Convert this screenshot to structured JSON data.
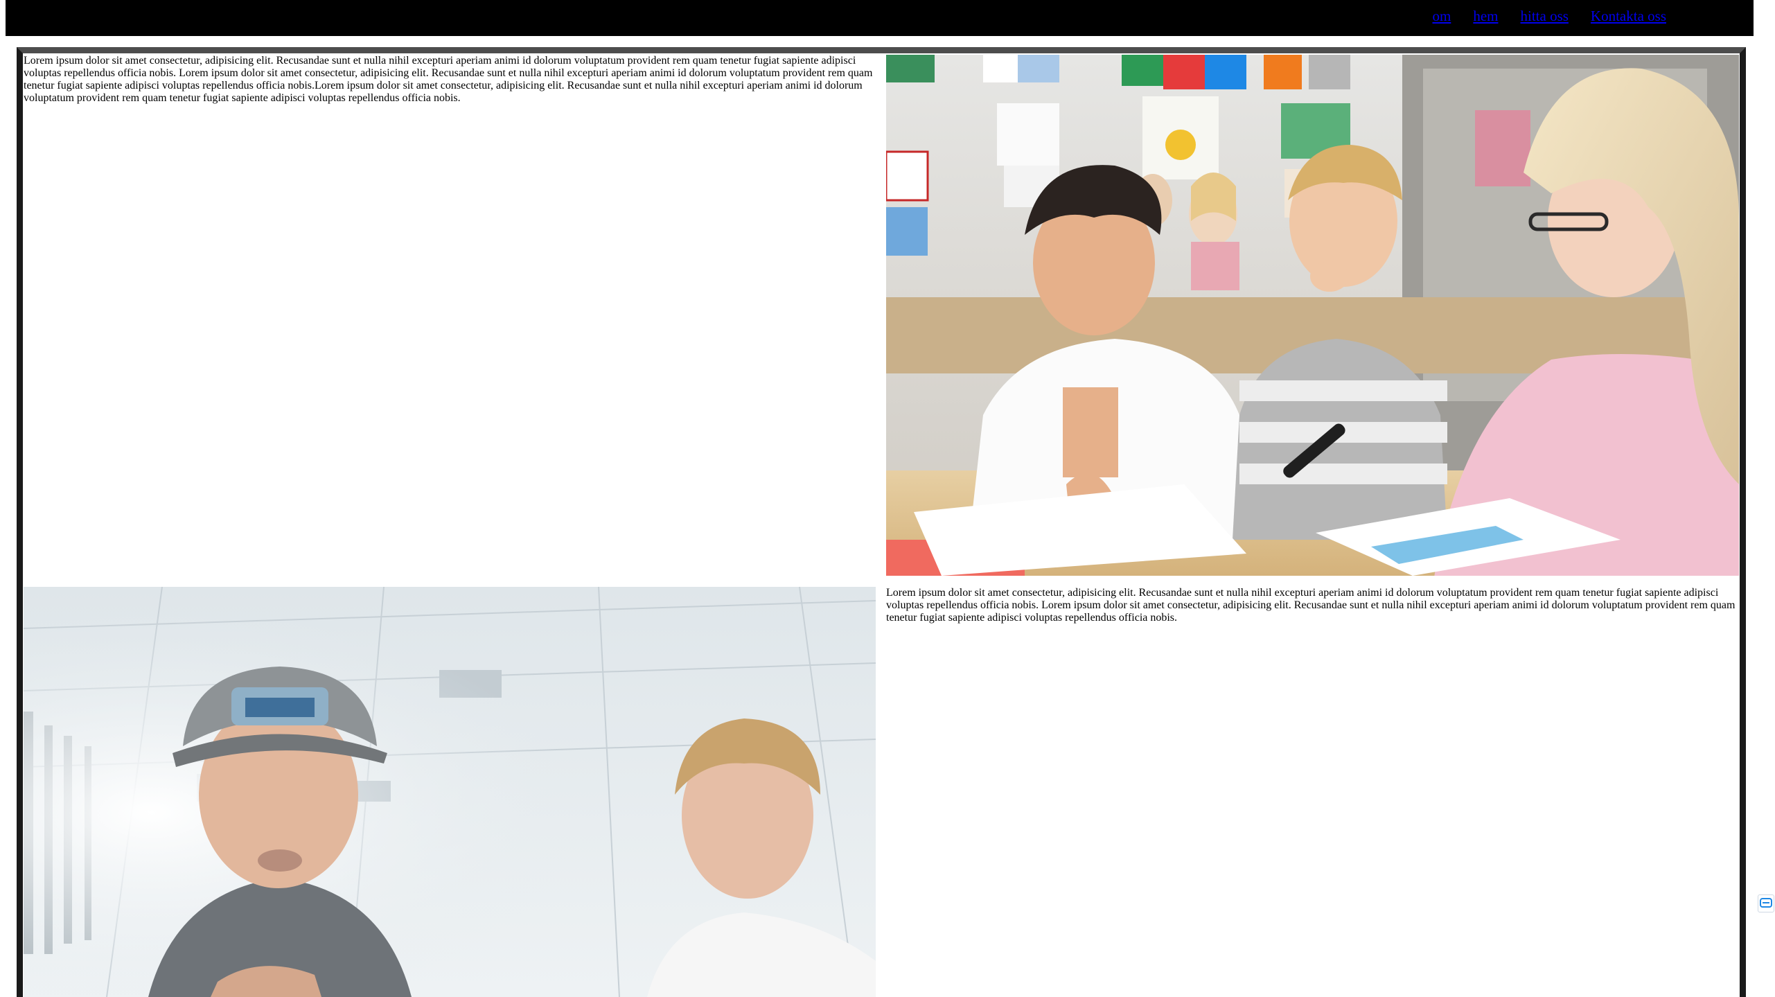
{
  "nav": {
    "links": [
      {
        "label": "om"
      },
      {
        "label": "hem"
      },
      {
        "label": "hitta oss"
      },
      {
        "label": "Kontakta oss"
      }
    ]
  },
  "content": {
    "block1_text": "Lorem ipsum dolor sit amet consectetur, adipisicing elit. Recusandae sunt et nulla nihil excepturi aperiam animi id dolorum voluptatum provident rem quam tenetur fugiat sapiente adipisci voluptas repellendus officia nobis. Lorem ipsum dolor sit amet consectetur, adipisicing elit. Recusandae sunt et nulla nihil excepturi aperiam animi id dolorum voluptatum provident rem quam tenetur fugiat sapiente adipisci voluptas repellendus officia nobis.Lorem ipsum dolor sit amet consectetur, adipisicing elit. Recusandae sunt et nulla nihil excepturi aperiam animi id dolorum voluptatum provident rem quam tenetur fugiat sapiente adipisci voluptas repellendus officia nobis.",
    "block2_text": "Lorem ipsum dolor sit amet consectetur, adipisicing elit. Recusandae sunt et nulla nihil excepturi aperiam animi id dolorum voluptatum provident rem quam tenetur fugiat sapiente adipisci voluptas repellendus officia nobis. Lorem ipsum dolor sit amet consectetur, adipisicing elit. Recusandae sunt et nulla nihil excepturi aperiam animi id dolorum voluptatum provident rem quam tenetur fugiat sapiente adipisci voluptas repellendus officia nobis."
  },
  "colors": {
    "navbar": "#000000",
    "link": "#0000ee",
    "frame_border": "#1a1a1a"
  }
}
